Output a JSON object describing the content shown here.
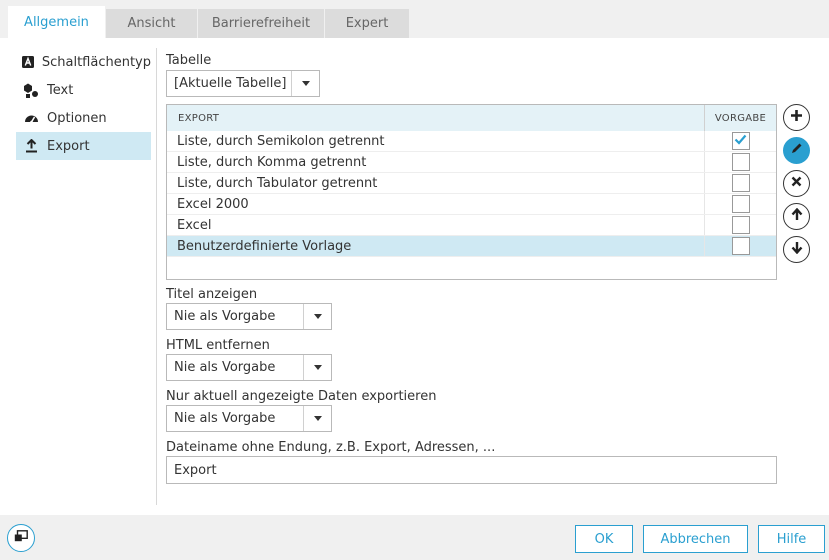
{
  "tabs": [
    {
      "label": "Allgemein",
      "active": true
    },
    {
      "label": "Ansicht",
      "active": false
    },
    {
      "label": "Barrierefreiheit",
      "active": false
    },
    {
      "label": "Expert",
      "active": false
    }
  ],
  "sidebar": {
    "items": [
      {
        "label": "Schaltflächentyp",
        "icon": "letter-a-icon",
        "active": false
      },
      {
        "label": "Text",
        "icon": "shapes-icon",
        "active": false
      },
      {
        "label": "Optionen",
        "icon": "gauge-icon",
        "active": false
      },
      {
        "label": "Export",
        "icon": "upload-icon",
        "active": true
      }
    ]
  },
  "table_field": {
    "label": "Tabelle",
    "value": "[Aktuelle Tabelle]"
  },
  "export_grid": {
    "col_export": "EXPORT",
    "col_default": "VORGABE",
    "rows": [
      {
        "label": "Liste, durch Semikolon getrennt",
        "default": true,
        "selected": false
      },
      {
        "label": "Liste, durch Komma getrennt",
        "default": false,
        "selected": false
      },
      {
        "label": "Liste, durch Tabulator getrennt",
        "default": false,
        "selected": false
      },
      {
        "label": "Excel 2000",
        "default": false,
        "selected": false
      },
      {
        "label": "Excel",
        "default": false,
        "selected": false
      },
      {
        "label": "Benutzerdefinierte Vorlage",
        "default": false,
        "selected": true
      }
    ]
  },
  "grid_actions": [
    "add-icon",
    "edit-icon",
    "delete-icon",
    "arrow-up-icon",
    "arrow-down-icon"
  ],
  "show_title": {
    "label": "Titel anzeigen",
    "value": "Nie als Vorgabe"
  },
  "remove_html": {
    "label": "HTML entfernen",
    "value": "Nie als Vorgabe"
  },
  "only_shown": {
    "label": "Nur aktuell angezeigte Daten exportieren",
    "value": "Nie als Vorgabe"
  },
  "filename": {
    "label": "Dateiname ohne Endung, z.B. Export, Adressen, ...",
    "value": "Export"
  },
  "footer": {
    "ok": "OK",
    "cancel": "Abbrechen",
    "help": "Hilfe"
  },
  "colors": {
    "accent": "#2a9fd0",
    "selected_row": "#cfe9f3",
    "header_bg": "#e4f2f7"
  }
}
